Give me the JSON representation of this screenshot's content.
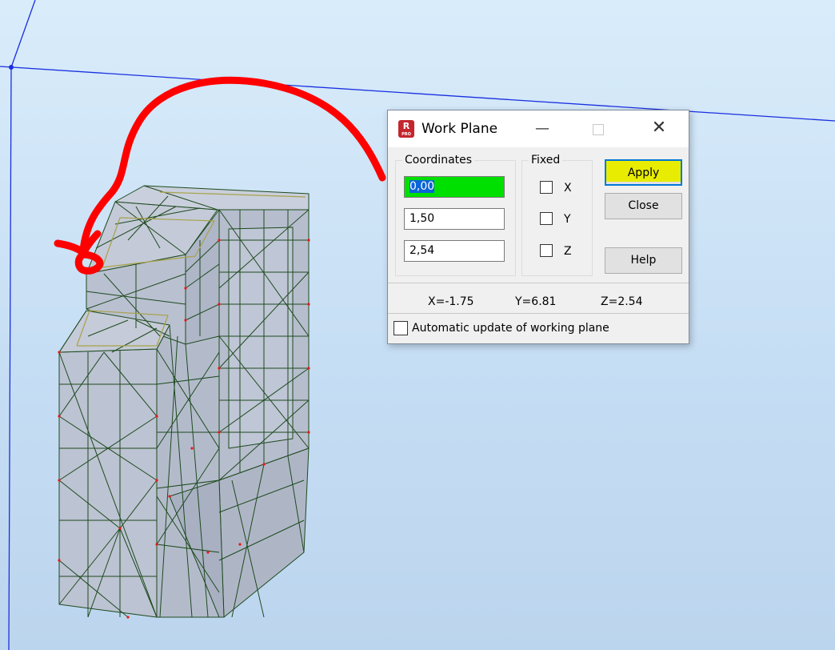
{
  "dialog": {
    "title": "Work Plane",
    "icon": "app-icon",
    "titlebar_buttons": {
      "minimize": "—",
      "maximize": "",
      "close": "✕"
    },
    "coordinates": {
      "label": "Coordinates",
      "x": "0,00",
      "y": "1,50",
      "z": "2,54"
    },
    "fixed": {
      "label": "Fixed",
      "x": "X",
      "y": "Y",
      "z": "Z"
    },
    "buttons": {
      "apply": "Apply",
      "close": "Close",
      "help": "Help"
    },
    "readout": {
      "x": "X=-1.75",
      "y": "Y=6.81",
      "z": "Z=2.54"
    },
    "auto_update_label": "Automatic update of working plane"
  },
  "colors": {
    "highlight_yellow": "#e8ec00",
    "field_green": "#00e000",
    "annotation_red": "#ff0000",
    "mesh_edge": "#1f4d1f"
  }
}
